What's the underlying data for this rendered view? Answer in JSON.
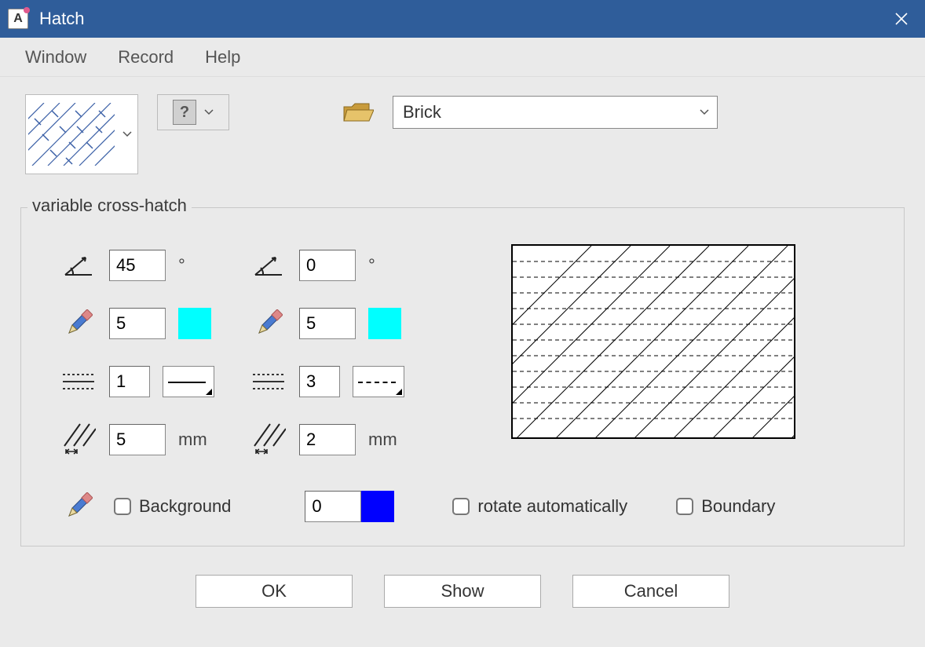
{
  "window": {
    "title": "Hatch"
  },
  "menu": {
    "window": "Window",
    "record": "Record",
    "help": "Help"
  },
  "combo": {
    "selected": "Brick"
  },
  "group": {
    "legend": "variable cross-hatch"
  },
  "set1": {
    "angle": "45",
    "angle_unit": "°",
    "pen": "5",
    "pen_color": "#00ffff",
    "linetype": "1",
    "spacing": "5",
    "spacing_unit": "mm"
  },
  "set2": {
    "angle": "0",
    "angle_unit": "°",
    "pen": "5",
    "pen_color": "#00ffff",
    "linetype": "3",
    "spacing": "2",
    "spacing_unit": "mm"
  },
  "bg": {
    "label": "Background",
    "pen": "0",
    "color": "#0000ff"
  },
  "rotate": {
    "label": "rotate automatically"
  },
  "boundary": {
    "label": "Boundary"
  },
  "buttons": {
    "ok": "OK",
    "show": "Show",
    "cancel": "Cancel"
  }
}
